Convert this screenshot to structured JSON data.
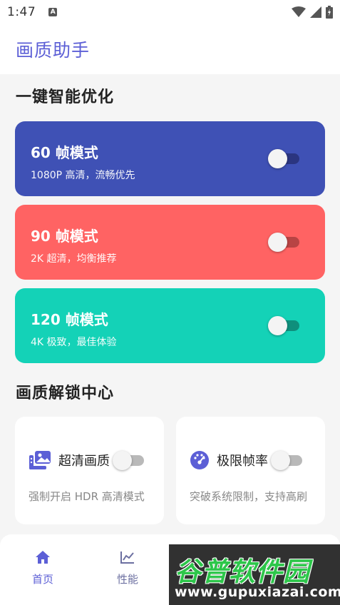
{
  "status_bar": {
    "time": "1:47"
  },
  "app_bar": {
    "title": "画质助手"
  },
  "section1": {
    "title": "一键智能优化"
  },
  "modes": [
    {
      "title": "60 帧模式",
      "subtitle": "1080P 高清，流畅优先",
      "color": "#3f51b5",
      "switch_on": false
    },
    {
      "title": "90 帧模式",
      "subtitle": "2K 超清，均衡推荐",
      "color": "#ff6363",
      "switch_on": false
    },
    {
      "title": "120 帧模式",
      "subtitle": "4K 极致，最佳体验",
      "color": "#14d2b7",
      "switch_on": false
    }
  ],
  "section2": {
    "title": "画质解锁中心"
  },
  "unlock": [
    {
      "label": "超清画质",
      "desc": "强制开启 HDR 高清模式",
      "icon": "image-gallery-icon",
      "switch_on": false
    },
    {
      "label": "极限帧率",
      "desc": "突破系统限制，支持高刷",
      "icon": "speedometer-icon",
      "switch_on": false
    }
  ],
  "bottom_nav": {
    "items": [
      {
        "label": "首页",
        "icon": "home-icon",
        "active": true
      },
      {
        "label": "性能",
        "icon": "chart-icon",
        "active": false
      }
    ]
  },
  "watermark": {
    "title": "谷普软件园",
    "url": "www.gupuxiazai.com"
  },
  "colors": {
    "accent": "#5c5fd6",
    "inactive_nav": "#6b6fa0"
  }
}
